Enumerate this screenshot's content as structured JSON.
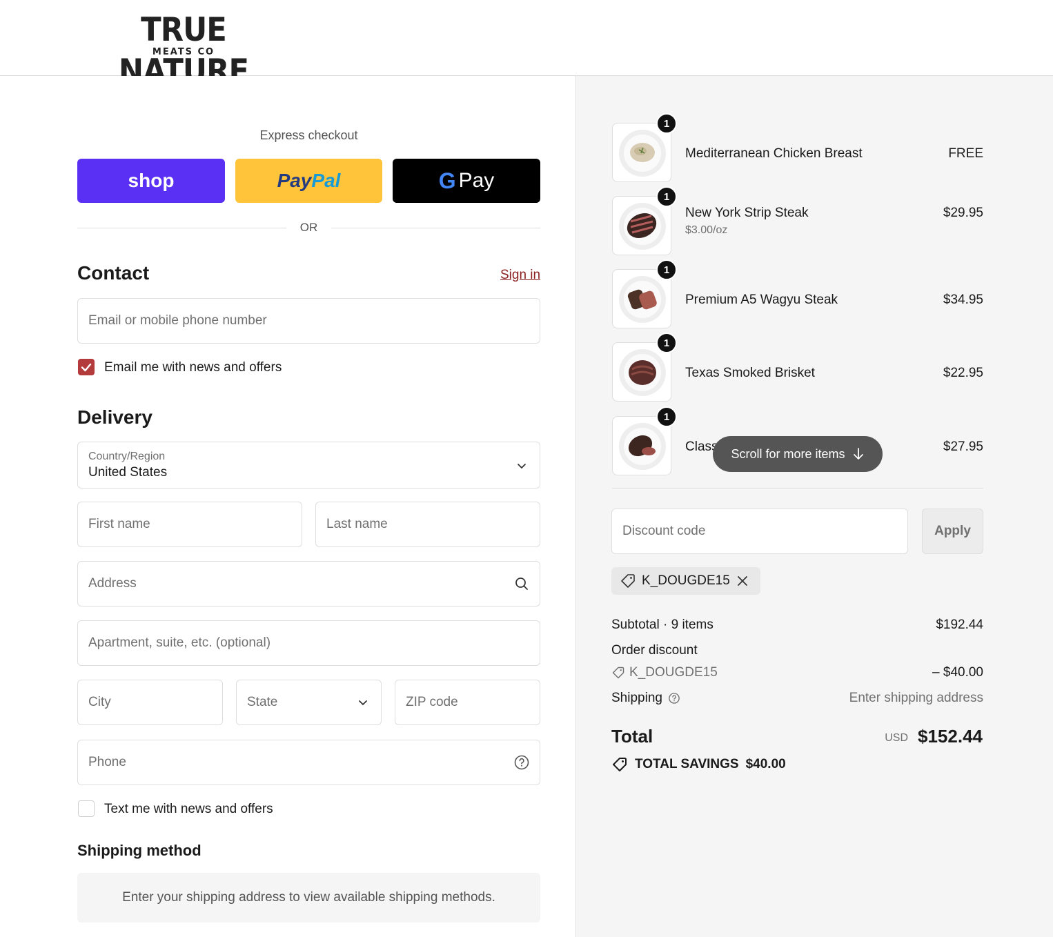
{
  "brand": {
    "name": "TRUE NATURE",
    "sub": "MEATS CO"
  },
  "express": {
    "title": "Express checkout",
    "shop_label": "shop",
    "paypal_part1": "Pay",
    "paypal_part2": "Pal",
    "gpay_g": "G",
    "gpay_label": "Pay",
    "or_label": "OR"
  },
  "contact": {
    "heading": "Contact",
    "signin_label": "Sign in",
    "email_placeholder": "Email or mobile phone number",
    "news_checkbox_label": "Email me with news and offers",
    "news_checked": true
  },
  "delivery": {
    "heading": "Delivery",
    "country_label": "Country/Region",
    "country_value": "United States",
    "first_name_placeholder": "First name",
    "last_name_placeholder": "Last name",
    "address_placeholder": "Address",
    "apartment_placeholder": "Apartment, suite, etc. (optional)",
    "city_placeholder": "City",
    "state_placeholder": "State",
    "zip_placeholder": "ZIP code",
    "phone_placeholder": "Phone",
    "sms_checkbox_label": "Text me with news and offers",
    "sms_checked": false
  },
  "shipping_method": {
    "heading": "Shipping method",
    "note": "Enter your shipping address to view available shipping methods."
  },
  "cart": {
    "items": [
      {
        "qty": "1",
        "name": "Mediterranean Chicken Breast",
        "sub": "",
        "price": "FREE"
      },
      {
        "qty": "1",
        "name": "New York Strip Steak",
        "sub": "$3.00/oz",
        "price": "$29.95"
      },
      {
        "qty": "1",
        "name": "Premium A5 Wagyu Steak",
        "sub": "",
        "price": "$34.95"
      },
      {
        "qty": "1",
        "name": "Texas Smoked Brisket",
        "sub": "",
        "price": "$22.95"
      },
      {
        "qty": "1",
        "name": "Classi",
        "sub": "",
        "price": "$27.95"
      }
    ],
    "scroll_hint": "Scroll for more items"
  },
  "discount": {
    "placeholder": "Discount code",
    "apply_label": "Apply",
    "applied_code": "K_DOUGDE15"
  },
  "summary": {
    "subtotal_label": "Subtotal · 9 items",
    "subtotal_value": "$192.44",
    "order_discount_label": "Order discount",
    "discount_code": "K_DOUGDE15",
    "discount_value": "– $40.00",
    "shipping_label": "Shipping",
    "shipping_value": "Enter shipping address",
    "total_label": "Total",
    "currency": "USD",
    "total_value": "$152.44",
    "savings_label": "TOTAL SAVINGS",
    "savings_value": "$40.00"
  },
  "colors": {
    "accent": "#b43b3b",
    "shop_purple": "#5a31f4",
    "paypal_yellow": "#ffc439"
  }
}
